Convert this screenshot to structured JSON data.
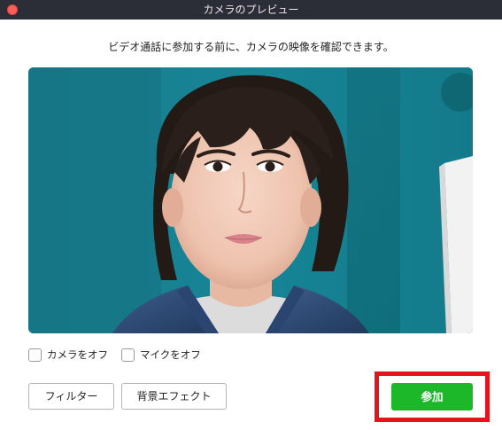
{
  "window": {
    "title": "カメラのプレビュー"
  },
  "instruction": "ビデオ通話に参加する前に、カメラの映像を確認できます。",
  "preview": {
    "image_alt": "Camera preview: person in front of a teal wall",
    "background_color": "#177f8f"
  },
  "toggles": {
    "camera_off_label": "カメラをオフ",
    "camera_off_checked": false,
    "mic_off_label": "マイクをオフ",
    "mic_off_checked": false
  },
  "buttons": {
    "filter_label": "フィルター",
    "background_effect_label": "背景エフェクト",
    "join_label": "参加"
  },
  "colors": {
    "titlebar": "#2b2d37",
    "join_button": "#1cb82a",
    "highlight": "#e3141c",
    "close_button": "#ff5f57"
  },
  "icons": {
    "close": "close-icon"
  }
}
